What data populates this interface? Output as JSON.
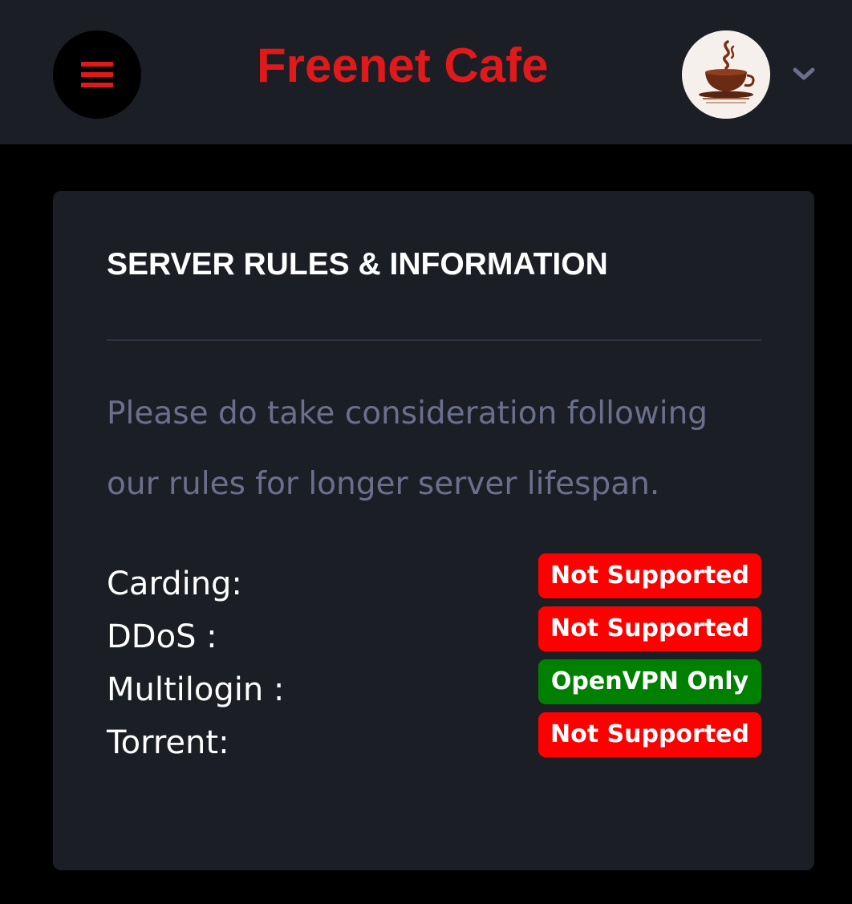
{
  "header": {
    "title": "Freenet Cafe",
    "menu_icon": "hamburger-menu-icon",
    "avatar_logo_text": "Freenet Cafe",
    "dropdown_icon": "chevron-down-icon"
  },
  "card": {
    "title": "SERVER RULES & INFORMATION",
    "intro": "Please do take consideration following our rules for longer server lifespan.",
    "rules": [
      {
        "label": "Carding:",
        "status": "Not Supported",
        "status_color": "#ff0000"
      },
      {
        "label": "DDoS :",
        "status": "Not Supported",
        "status_color": "#ff0000"
      },
      {
        "label": "Multilogin :",
        "status": "OpenVPN Only",
        "status_color": "#008000"
      },
      {
        "label": "Torrent:",
        "status": "Not Supported",
        "status_color": "#ff0000"
      }
    ]
  },
  "colors": {
    "brand": "#e0191b",
    "surface": "#1c1e26",
    "background": "#000000",
    "muted_text": "#6b6f8c"
  }
}
